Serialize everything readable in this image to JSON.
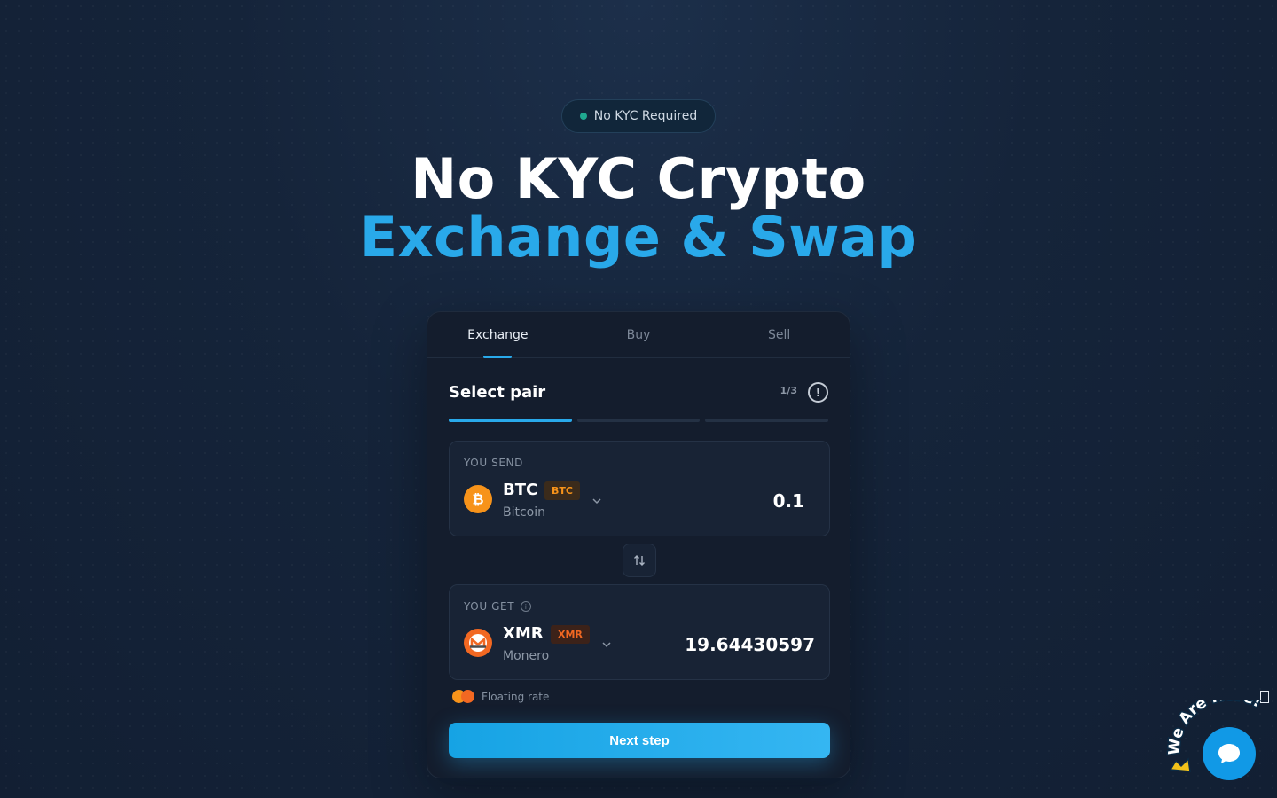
{
  "badge": {
    "text": "No KYC Required",
    "dot_color": "#1fa890"
  },
  "hero": {
    "line1": "No KYC Crypto",
    "line2": "Exchange & Swap"
  },
  "tabs": [
    {
      "label": "Exchange",
      "active": true
    },
    {
      "label": "Buy",
      "active": false
    },
    {
      "label": "Sell",
      "active": false
    }
  ],
  "step": {
    "title": "Select pair",
    "count": "1/3",
    "info_icon": "exclamation-circle-icon",
    "progress_fraction": 0.333
  },
  "send": {
    "label": "YOU SEND",
    "ticker": "BTC",
    "tag": "BTC",
    "name": "Bitcoin",
    "amount": "0.1",
    "icon": "bitcoin-icon"
  },
  "swap_icon": "swap-vertical-icon",
  "get": {
    "label": "YOU GET",
    "ticker": "XMR",
    "tag": "XMR",
    "name": "Monero",
    "amount": "19.64430597",
    "icon": "monero-icon"
  },
  "rate": {
    "label": "Floating rate"
  },
  "cta": {
    "label": "Next step"
  },
  "chat": {
    "banner": "We Are Here!",
    "icon": "chat-bubble-icon"
  },
  "colors": {
    "accent": "#29a9ea",
    "btc": "#f7931a",
    "xmr": "#f26822",
    "background": "#15243a"
  }
}
